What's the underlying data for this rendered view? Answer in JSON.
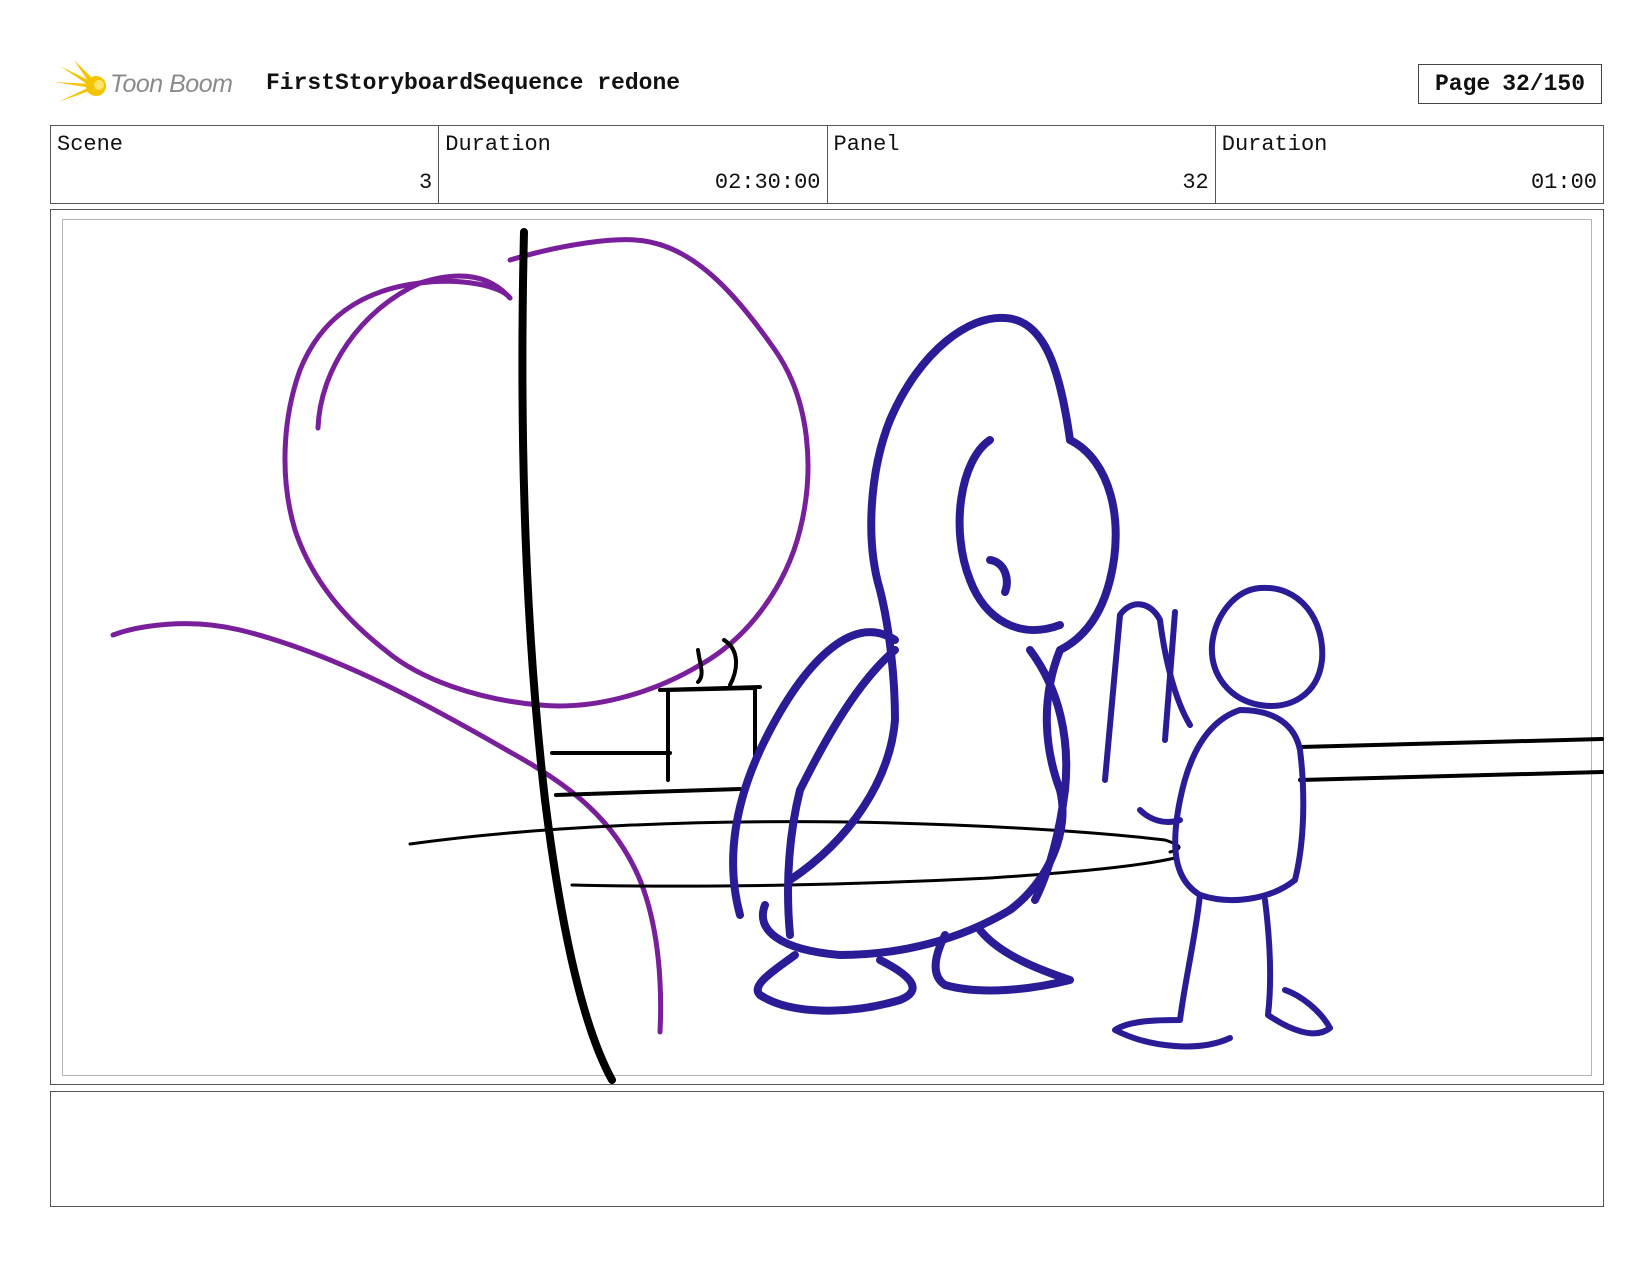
{
  "header": {
    "logo_text": "Toon Boom",
    "title": "FirstStoryboardSequence redone",
    "page_label": "Page",
    "page_value": "32/150"
  },
  "info": [
    {
      "label": "Scene",
      "value": "3"
    },
    {
      "label": "Duration",
      "value": "02:30:00"
    },
    {
      "label": "Panel",
      "value": "32"
    },
    {
      "label": "Duration",
      "value": "01:00"
    }
  ],
  "colors": {
    "purple": "#7a1f9c",
    "blue": "#2a1c96",
    "black": "#000000",
    "logo_yellow": "#f5c400"
  },
  "notes": ""
}
